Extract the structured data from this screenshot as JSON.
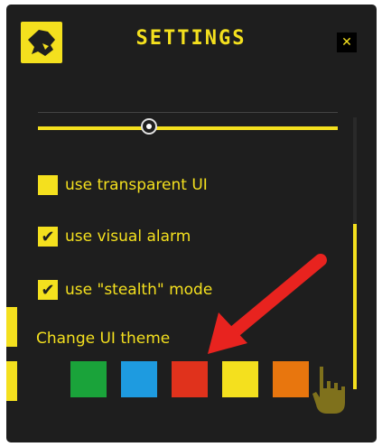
{
  "window": {
    "title": "SETTINGS",
    "close_label": "✕",
    "logo_icon": "brand-logo-icon",
    "close_icon": "close-icon"
  },
  "slider": {
    "value": 0.37,
    "icon": "slider-thumb-icon"
  },
  "options": [
    {
      "label": "use transparent UI",
      "checked": false
    },
    {
      "label": "use visual alarm",
      "checked": true
    },
    {
      "label": "use \"stealth\" mode",
      "checked": true
    }
  ],
  "theme": {
    "label": "Change UI theme",
    "swatches": [
      {
        "color": "#1aa33a"
      },
      {
        "color": "#1e9be0"
      },
      {
        "color": "#e0321c"
      },
      {
        "color": "#f4e01e"
      },
      {
        "color": "#e8760e"
      }
    ]
  },
  "colors": {
    "accent": "#f4e01e",
    "background": "#1e1e1e",
    "annotation_arrow": "#e8231f"
  },
  "annotation": {
    "arrow_icon": "red-arrow-icon",
    "cursor_icon": "hand-cursor-icon"
  }
}
